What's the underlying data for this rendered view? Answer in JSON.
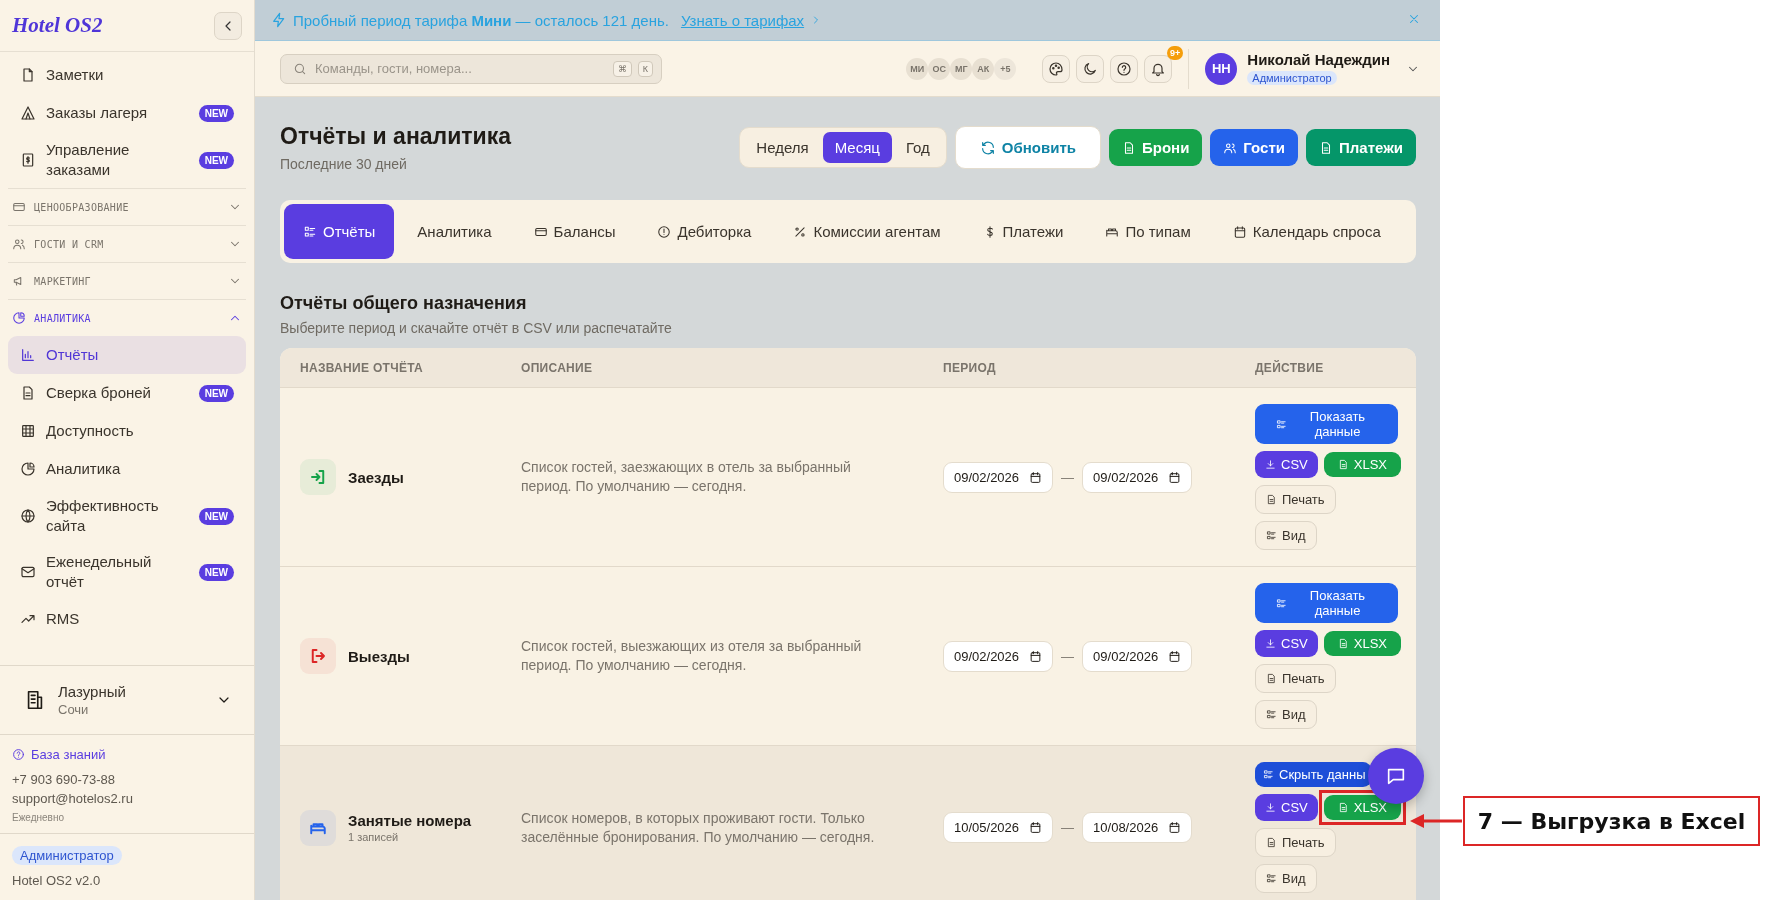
{
  "sidebar": {
    "logo": "Hotel OS2",
    "items": [
      {
        "kind": "item",
        "label": "Заметки",
        "selected": false
      },
      {
        "kind": "item",
        "label": "Заказы лагеря",
        "badge": "NEW",
        "selected": false
      },
      {
        "kind": "item",
        "label": "Управление заказами",
        "badge": "NEW",
        "selected": false
      },
      {
        "kind": "section",
        "label": "ЦЕНООБРАЗОВАНИЕ",
        "expanded": false
      },
      {
        "kind": "section",
        "label": "ГОСТИ И CRM",
        "expanded": false
      },
      {
        "kind": "section",
        "label": "МАРКЕТИНГ",
        "expanded": false
      },
      {
        "kind": "section",
        "label": "АНАЛИТИКА",
        "expanded": true
      },
      {
        "kind": "item",
        "label": "Отчёты",
        "selected": true
      },
      {
        "kind": "item",
        "label": "Сверка броней",
        "badge": "NEW",
        "selected": false
      },
      {
        "kind": "item",
        "label": "Доступность",
        "selected": false
      },
      {
        "kind": "item",
        "label": "Аналитика",
        "selected": false
      },
      {
        "kind": "item",
        "label": "Эффективность сайта",
        "badge": "NEW",
        "selected": false
      },
      {
        "kind": "item",
        "label": "Еженедельный отчёт",
        "badge": "NEW",
        "selected": false
      },
      {
        "kind": "item",
        "label": "RMS",
        "selected": false
      }
    ],
    "hotel": {
      "name": "Лазурный",
      "city": "Сочи"
    },
    "support": {
      "link": "База знаний",
      "phone": "+7 903 690-73-88",
      "email": "support@hotelos2.ru",
      "hours": "Ежедневно"
    },
    "role": "Администратор",
    "version": "Hotel OS2 v2.0"
  },
  "banner": {
    "text": "Пробный период тарифа **Мини** — осталось 121 день.",
    "link": "Узнать о тарифах"
  },
  "topbar": {
    "search": {
      "placeholder": "Команды, гости, номера..."
    },
    "shortcut_keys": [
      "⌘",
      "К"
    ],
    "avatars": [
      "МИ",
      "ОС",
      "МГ",
      "АК"
    ],
    "more_users": "+5",
    "notification_count": "9+",
    "user": {
      "initials": "НН",
      "name": "Николай Надеждин",
      "role": "Администратор"
    }
  },
  "header": {
    "title": "Отчёты и аналитика",
    "subtitle": "Последние 30 дней",
    "periods": [
      {
        "label": "Неделя",
        "selected": false
      },
      {
        "label": "Месяц",
        "selected": true
      },
      {
        "label": "Год",
        "selected": false
      }
    ],
    "refresh": "Обновить",
    "exports": [
      {
        "label": "Брони",
        "color": "#16a34a"
      },
      {
        "label": "Гости",
        "color": "#2563eb"
      },
      {
        "label": "Платежи",
        "color": "#059669"
      }
    ]
  },
  "tabs": [
    {
      "label": "Отчёты",
      "selected": true
    },
    {
      "label": "Аналитика",
      "selected": false
    },
    {
      "label": "Балансы",
      "selected": false
    },
    {
      "label": "Дебиторка",
      "selected": false
    },
    {
      "label": "Комиссии агентам",
      "selected": false
    },
    {
      "label": "Платежи",
      "selected": false
    },
    {
      "label": "По типам",
      "selected": false
    },
    {
      "label": "Календарь спроса",
      "selected": false
    }
  ],
  "section": {
    "title": "Отчёты общего назначения",
    "subtitle": "Выберите период и скачайте отчёт в CSV или распечатайте"
  },
  "table": {
    "columns": [
      "НАЗВАНИЕ ОТЧЁТА",
      "ОПИСАНИЕ",
      "ПЕРИОД",
      "ДЕЙСТВИЕ"
    ],
    "rows": [
      {
        "name": "Заезды",
        "color": "#16a34a",
        "description": "Список гостей, заезжающих в отель за выбранный период. По умолчанию — сегодня.",
        "from": "09/02/2026",
        "separator": "—",
        "to": "09/02/2026",
        "toggle": "Показать данные",
        "expanded": false,
        "csv": "CSV",
        "xlsx": "XLSX",
        "xlsx_highlighted": false,
        "print": "Печать",
        "view": "Вид"
      },
      {
        "name": "Выезды",
        "color": "#dc2626",
        "description": "Список гостей, выезжающих из отеля за выбранный период. По умолчанию — сегодня.",
        "from": "09/02/2026",
        "separator": "—",
        "to": "09/02/2026",
        "toggle": "Показать данные",
        "expanded": false,
        "csv": "CSV",
        "xlsx": "XLSX",
        "xlsx_highlighted": false,
        "print": "Печать",
        "view": "Вид"
      },
      {
        "name": "Занятые номера",
        "count": "1 записей",
        "color": "#2563eb",
        "description": "Список номеров, в которых проживают гости. Только заселённые бронирования. По умолчанию — сегодня.",
        "from": "10/05/2026",
        "separator": "—",
        "to": "10/08/2026",
        "toggle": "Скрыть данны",
        "expanded": true,
        "csv": "CSV",
        "xlsx": "XLSX",
        "xlsx_highlighted": true,
        "print": "Печать",
        "view": "Вид"
      }
    ]
  },
  "annotation": {
    "text": "7 — Выгрузка в Excel"
  }
}
